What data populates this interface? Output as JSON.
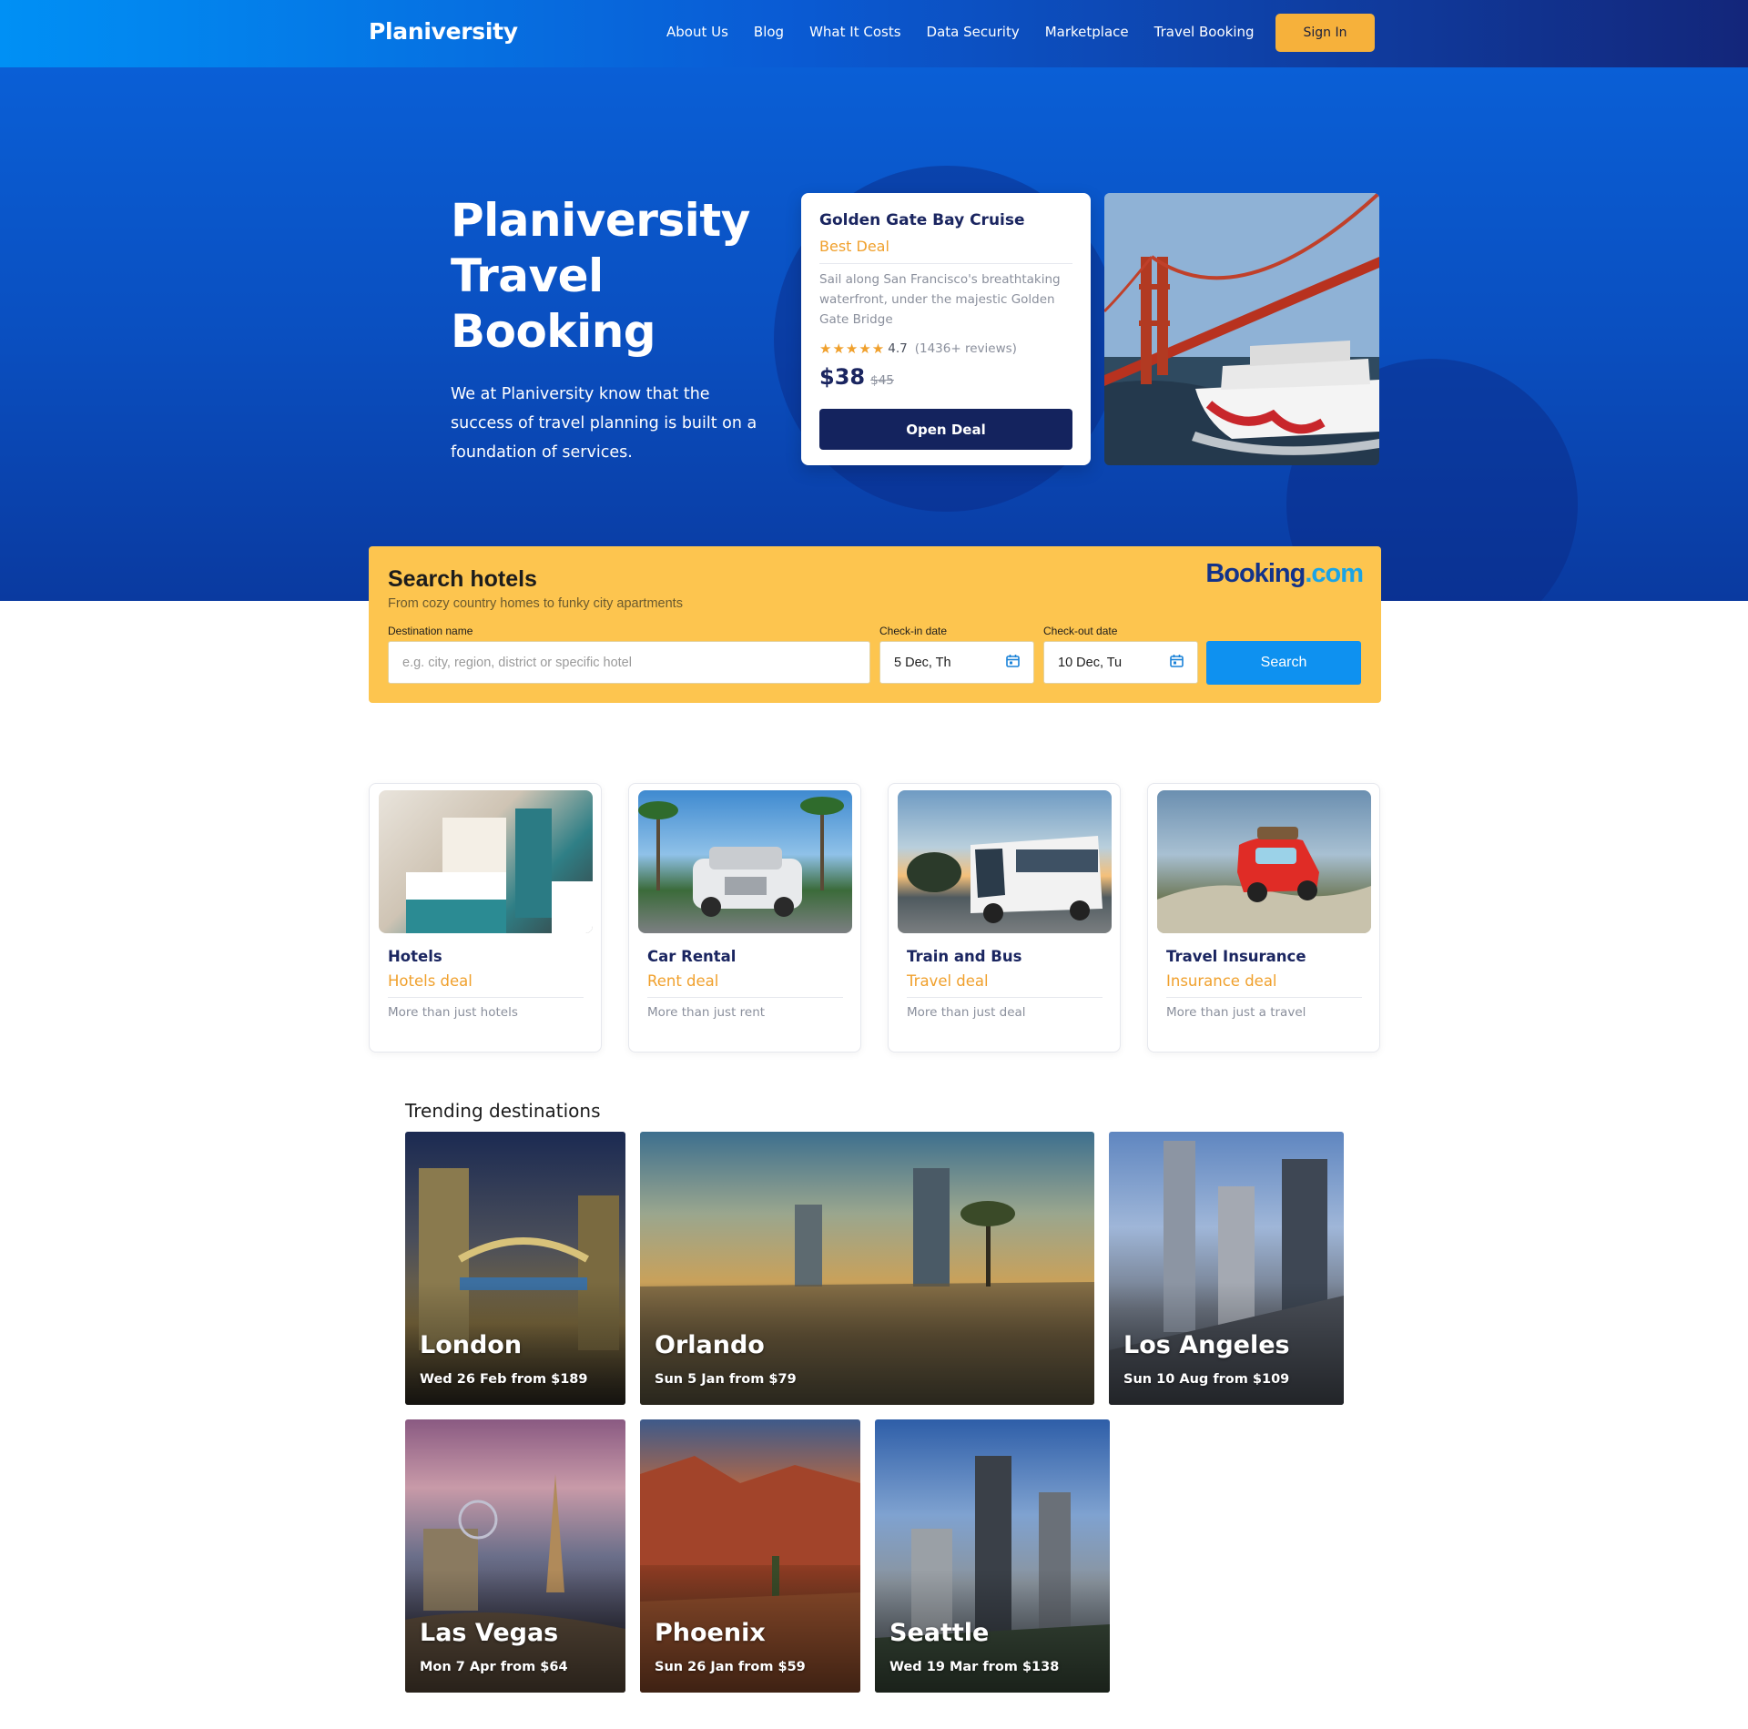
{
  "header": {
    "logo": "Planiversity",
    "nav": [
      "About Us",
      "Blog",
      "What It Costs",
      "Data Security",
      "Marketplace",
      "Travel Booking"
    ],
    "sign_in": "Sign In"
  },
  "hero": {
    "title": "Planiversity Travel Booking",
    "subtitle": "We at Planiversity know that the success of travel planning is built on a foundation of services."
  },
  "deal": {
    "title": "Golden Gate Bay Cruise",
    "tag": "Best Deal",
    "description": "Sail along San Francisco's breathtaking waterfront, under the majestic Golden Gate Bridge",
    "stars": "★★★★★",
    "rating": "4.7",
    "reviews": "(1436+ reviews)",
    "price": "$38",
    "old_price": "$45",
    "button": "Open Deal"
  },
  "search": {
    "title": "Search hotels",
    "subtitle": "From cozy country homes to funky city apartments",
    "brand_part1": "Booking",
    "brand_part2": ".com",
    "destination_label": "Destination name",
    "destination_placeholder": "e.g. city, region, district or specific hotel",
    "checkin_label": "Check-in date",
    "checkin_value": "5 Dec, Th",
    "checkout_label": "Check-out date",
    "checkout_value": "10 Dec, Tu",
    "button": "Search"
  },
  "services": [
    {
      "name": "Hotels",
      "tag": "Hotels deal",
      "desc": "More than just hotels"
    },
    {
      "name": "Car Rental",
      "tag": "Rent deal",
      "desc": "More than just rent"
    },
    {
      "name": "Train and Bus",
      "tag": "Travel deal",
      "desc": "More than just deal"
    },
    {
      "name": "Travel Insurance",
      "tag": "Insurance deal",
      "desc": "More than just a travel"
    }
  ],
  "trending": {
    "heading": "Trending destinations",
    "items": [
      {
        "city": "London",
        "info": "Wed 26 Feb from $189"
      },
      {
        "city": "Orlando",
        "info": "Sun 5 Jan from $79"
      },
      {
        "city": "Los Angeles",
        "info": "Sun 10 Aug from $109"
      },
      {
        "city": "Las Vegas",
        "info": "Mon 7 Apr from $64"
      },
      {
        "city": "Phoenix",
        "info": "Sun 26 Jan from $59"
      },
      {
        "city": "Seattle",
        "info": "Wed 19 Mar from $138"
      }
    ]
  },
  "colors": {
    "accent_orange": "#f0a02c",
    "navy": "#14235e",
    "booking_yellow": "#fdc54f",
    "search_blue": "#0e91f0"
  }
}
